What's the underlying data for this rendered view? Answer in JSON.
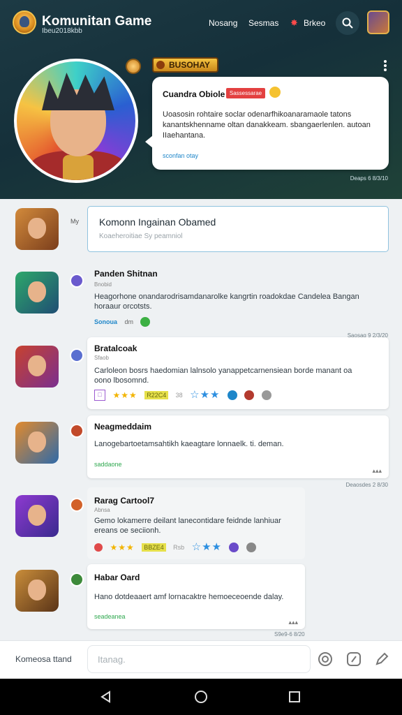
{
  "header": {
    "title": "Komunitan Game",
    "subtitle": "Ibeu2018kbb",
    "nav": [
      "Nosang",
      "Sesmas",
      "Brkeo"
    ],
    "rank_badge": "BUSOHAY",
    "colors": {
      "bg": "#1d3a44",
      "accent": "#f5c542",
      "fire": "#ff4a4a"
    }
  },
  "featured": {
    "name": "Cuandra Obiole",
    "tag": "Sassessarae",
    "text": "Uoasosin rohtaire soclar odenarfhikoanaramaole tatons kanantskhenname oltan danakkeam. sbangaerlenlen. autoan IIaehantana.",
    "link": "sconfan otay",
    "time": "Deaps 6 8/3/10"
  },
  "compose": {
    "label": "My",
    "title": "Komonn Ingainan Obamed",
    "subtitle": "Koaeheroitiae Sy peamniol"
  },
  "posts": [
    {
      "title": "Panden Shitnan",
      "sub": "Bnobid",
      "body": "Heagorhone onandarodrisamdanarolke kangrtin roadokdae Candelea Bangan horaaur orcotsts.",
      "link": "Sonoua",
      "meta": "dm",
      "time": "Saosag 9 2/3/20"
    },
    {
      "title": "Bratalcoak",
      "sub": "Sfaob",
      "body": "Carloleon bosrs haedomian lalnsolo yanappetcarnensiean borde manant oa oono lbosomnd.",
      "badge": "R22C4",
      "level": "38"
    },
    {
      "title": "Neagmeddaim",
      "body": "Lanogebartoetamsahtikh kaeagtare lonnaelk. ti. deman.",
      "link": "saddaone",
      "time": "Deaosdes 2 8/30"
    },
    {
      "title": "Rarag Cartool7",
      "sub": "Abnsa",
      "body": "Gemo lokamerre deilant lanecontidare feidnde lanhiuar ereans oe seciionh.",
      "badge": "BBZE4",
      "level": "Rsb"
    },
    {
      "title": "Habar Oard",
      "body": "Hano dotdeaaert amf lornacaktre hemoeceoende dalay.",
      "link": "seadeanea",
      "time": "S9e9-6 8/20"
    }
  ],
  "bottom": {
    "label": "Komeosa ttand",
    "placeholder": "Itanag."
  }
}
